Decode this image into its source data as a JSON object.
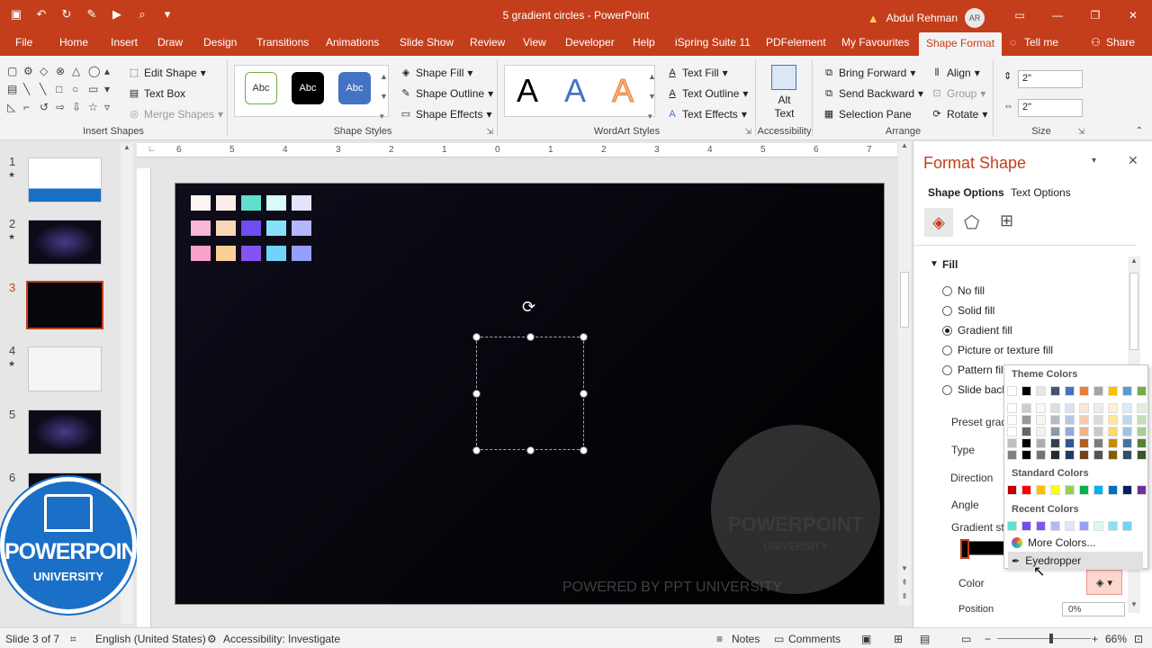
{
  "window": {
    "title": "5 gradient circles - PowerPoint",
    "user_name": "Abdul Rehman",
    "user_initials": "AR",
    "warning_icon": "warning-icon"
  },
  "tabs": [
    "File",
    "Home",
    "Insert",
    "Draw",
    "Design",
    "Transitions",
    "Animations",
    "Slide Show",
    "Review",
    "View",
    "Developer",
    "Help",
    "iSpring Suite 11",
    "PDFelement",
    "My Favourites",
    "Shape Format",
    "Tell me",
    "Share"
  ],
  "ribbon": {
    "insert_shapes": {
      "label": "Insert Shapes",
      "edit_shape": "Edit Shape",
      "text_box": "Text Box",
      "merge_shapes": "Merge Shapes"
    },
    "shape_styles": {
      "label": "Shape Styles",
      "styles": [
        "Abc",
        "Abc",
        "Abc"
      ],
      "fill": "Shape Fill",
      "outline": "Shape Outline",
      "effects": "Shape Effects"
    },
    "wordart": {
      "label": "WordArt Styles",
      "letters": [
        "A",
        "A",
        "A"
      ],
      "text_fill": "Text Fill",
      "text_outline": "Text Outline",
      "text_effects": "Text Effects"
    },
    "accessibility": {
      "label": "Accessibility",
      "alt_text_1": "Alt",
      "alt_text_2": "Text"
    },
    "arrange": {
      "label": "Arrange",
      "bring_forward": "Bring Forward",
      "send_backward": "Send Backward",
      "selection_pane": "Selection Pane",
      "align": "Align",
      "group": "Group",
      "rotate": "Rotate"
    },
    "size": {
      "label": "Size",
      "height": "2\"",
      "width": "2\""
    }
  },
  "slides": [
    {
      "num": "1",
      "star": "★"
    },
    {
      "num": "2",
      "star": "★"
    },
    {
      "num": "3",
      "star": ""
    },
    {
      "num": "4",
      "star": "★"
    },
    {
      "num": "5",
      "star": ""
    },
    {
      "num": "6",
      "star": ""
    }
  ],
  "logo": {
    "line1": "POWERPOINT",
    "line2": "UNIVERSITY"
  },
  "ruler": {
    "labels": [
      "6",
      "5",
      "4",
      "3",
      "2",
      "1",
      "0",
      "1",
      "2",
      "3",
      "4",
      "5",
      "6",
      "7"
    ]
  },
  "slide": {
    "swatch_colors": [
      [
        "#fdf4f3",
        "#fbeeea",
        "#5fe0cf",
        "#d8fbf6",
        "#e2e4fc"
      ],
      [
        "#f8b7d2",
        "#f7d7b5",
        "#6f4cf3",
        "#87e1f9",
        "#b3b7fb"
      ],
      [
        "#f8a2c9",
        "#fbcf97",
        "#8353f5",
        "#6fd3fa",
        "#959ffb"
      ]
    ],
    "footer_text": "POWERED BY PPT UNIVERSITY",
    "watermark_1": "POWERPOINT",
    "watermark_2": "UNIVERSITY"
  },
  "pane": {
    "title": "Format Shape",
    "tabs": [
      "Shape Options",
      "Text Options"
    ],
    "section": "Fill",
    "fill_options": [
      "No fill",
      "Solid fill",
      "Gradient fill",
      "Picture or texture fill",
      "Pattern fill",
      "Slide background fill"
    ],
    "selected_fill": "Gradient fill",
    "labels": [
      "Preset gradients",
      "Type",
      "Direction",
      "Angle",
      "Gradient stops",
      "Color",
      "Position"
    ],
    "position_value": "0%"
  },
  "color_popup": {
    "theme_heading": "Theme Colors",
    "standard_heading": "Standard Colors",
    "recent_heading": "Recent Colors",
    "theme_top": [
      "#ffffff",
      "#000000",
      "#e7e6e6",
      "#44546a",
      "#4472c4",
      "#ed7d31",
      "#a5a5a5",
      "#ffc000",
      "#5b9bd5",
      "#70ad47"
    ],
    "standard": [
      "#c00000",
      "#ff0000",
      "#ffc000",
      "#ffff00",
      "#92d050",
      "#00b050",
      "#00b0f0",
      "#0070c0",
      "#002060",
      "#7030a0"
    ],
    "recent": [
      "#5fe0cf",
      "#6f4cf3",
      "#8353f5",
      "#b3b7fb",
      "#e2e4fc",
      "#959ffb",
      "#d8fbf6",
      "#87e1f9",
      "#6fd3fa"
    ],
    "more_colors": "More Colors...",
    "eyedropper": "Eyedropper"
  },
  "status": {
    "slide_info": "Slide 3 of 7",
    "language": "English (United States)",
    "accessibility": "Accessibility: Investigate",
    "notes": "Notes",
    "comments": "Comments",
    "zoom": "66%"
  }
}
